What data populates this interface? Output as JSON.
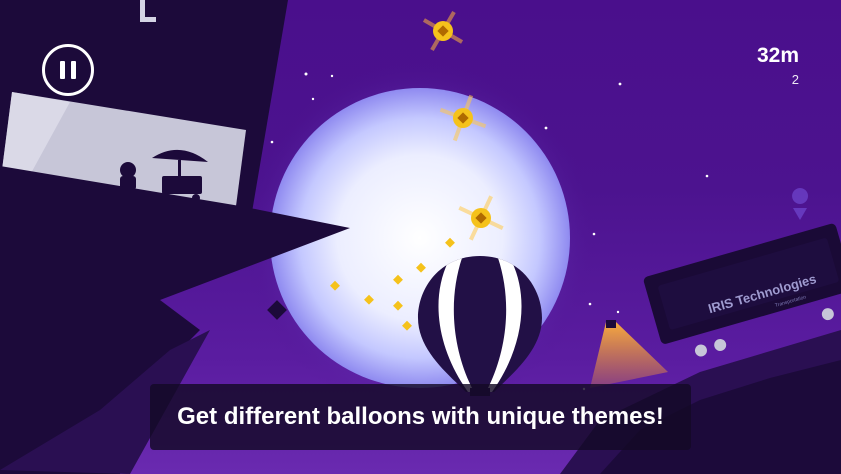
{
  "hud": {
    "distance": "32m",
    "coins": "2"
  },
  "billboard": {
    "brand": "IRIS Technologies",
    "subtext": "Transportation"
  },
  "caption": {
    "text": "Get different balloons with unique themes!"
  },
  "colors": {
    "sky": "#4c138f",
    "moon": "#e9ecff",
    "silhouette": "#1c0a3a",
    "coin": "#f5c21b",
    "balloon_dark": "#221046",
    "balloon_light": "#ffffff",
    "caption_bg": "#140a26"
  }
}
